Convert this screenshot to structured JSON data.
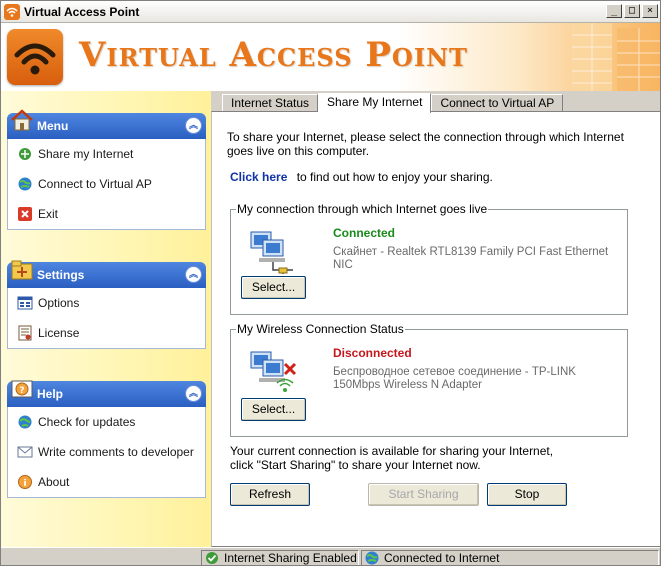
{
  "window": {
    "title": "Virtual Access Point",
    "minimize": "_",
    "maximize": "□",
    "close": "×"
  },
  "banner": {
    "brand": "Virtual Access Point"
  },
  "sidebar": {
    "menu": {
      "title": "Menu",
      "items": [
        {
          "label": "Share my Internet",
          "icon": "share-internet-icon"
        },
        {
          "label": "Connect to Virtual AP",
          "icon": "globe-icon"
        },
        {
          "label": "Exit",
          "icon": "exit-icon"
        }
      ]
    },
    "settings": {
      "title": "Settings",
      "items": [
        {
          "label": "Options",
          "icon": "options-icon"
        },
        {
          "label": "License",
          "icon": "license-icon"
        }
      ]
    },
    "help": {
      "title": "Help",
      "items": [
        {
          "label": "Check for updates",
          "icon": "update-icon"
        },
        {
          "label": "Write comments to developer",
          "icon": "mail-icon"
        },
        {
          "label": "About",
          "icon": "about-icon"
        }
      ]
    }
  },
  "tabs": [
    {
      "label": "Internet Status",
      "active": false
    },
    {
      "label": "Share My Internet",
      "active": true
    },
    {
      "label": "Connect to Virtual AP",
      "active": false
    }
  ],
  "content": {
    "intro": "To share your Internet, please select the connection through which Internet goes live on this computer.",
    "click_link": "Click here",
    "click_text": "to find out how to enjoy your sharing.",
    "connection_group": {
      "legend": "My connection  through which Internet goes live",
      "status": "Connected",
      "status_color": "#1a8a1a",
      "description": "Скайнет - Realtek RTL8139 Family PCI Fast Ethernet NIC",
      "select_label": "Select..."
    },
    "wireless_group": {
      "legend": "My Wireless Connection Status",
      "status": "Disconnected",
      "status_color": "#c4171e",
      "description": "Беспроводное сетевое соединение - TP-LINK 150Mbps Wireless N Adapter",
      "select_label": "Select..."
    },
    "footer_note_1": "Your current connection is available for sharing your Internet,",
    "footer_note_2": "click \"Start Sharing\" to share your Internet now.",
    "buttons": {
      "refresh": "Refresh",
      "start_sharing": "Start Sharing",
      "stop": "Stop"
    }
  },
  "statusbar": {
    "sharing": "Internet Sharing Enabled",
    "connection": "Connected to Internet"
  }
}
